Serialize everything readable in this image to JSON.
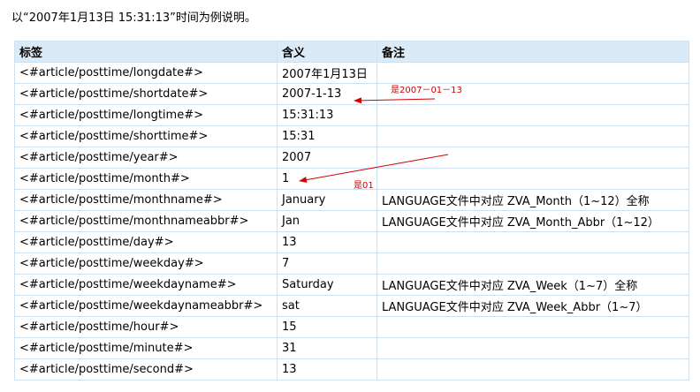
{
  "intro_text": "以“2007年1月13日 15:31:13”时间为例说明。",
  "table": {
    "headers": [
      "标签",
      "含义",
      "备注"
    ],
    "rows": [
      {
        "tag": "<#article/posttime/longdate#>",
        "meaning": "2007年1月13日",
        "note": ""
      },
      {
        "tag": "<#article/posttime/shortdate#>",
        "meaning": "2007-1-13",
        "note": ""
      },
      {
        "tag": "<#article/posttime/longtime#>",
        "meaning": "15:31:13",
        "note": ""
      },
      {
        "tag": "<#article/posttime/shorttime#>",
        "meaning": "15:31",
        "note": ""
      },
      {
        "tag": "<#article/posttime/year#>",
        "meaning": "2007",
        "note": ""
      },
      {
        "tag": "<#article/posttime/month#>",
        "meaning": "1",
        "note": ""
      },
      {
        "tag": "<#article/posttime/monthname#>",
        "meaning": "January",
        "note": "LANGUAGE文件中对应 ZVA_Month（1~12）全称"
      },
      {
        "tag": "<#article/posttime/monthnameabbr#>",
        "meaning": "Jan",
        "note": "LANGUAGE文件中对应 ZVA_Month_Abbr（1~12）"
      },
      {
        "tag": "<#article/posttime/day#>",
        "meaning": "13",
        "note": ""
      },
      {
        "tag": "<#article/posttime/weekday#>",
        "meaning": "7",
        "note": ""
      },
      {
        "tag": "<#article/posttime/weekdayname#>",
        "meaning": "Saturday",
        "note": "LANGUAGE文件中对应 ZVA_Week（1~7）全称"
      },
      {
        "tag": "<#article/posttime/weekdaynameabbr#>",
        "meaning": "sat",
        "note": "LANGUAGE文件中对应 ZVA_Week_Abbr（1~7）"
      },
      {
        "tag": "<#article/posttime/hour#>",
        "meaning": "15",
        "note": ""
      },
      {
        "tag": "<#article/posttime/minute#>",
        "meaning": "31",
        "note": ""
      },
      {
        "tag": "<#article/posttime/second#>",
        "meaning": "13",
        "note": ""
      }
    ]
  },
  "annotations": {
    "shortdate_note": "是2007－01－13",
    "month_note": "是01",
    "color": "#d40000"
  }
}
